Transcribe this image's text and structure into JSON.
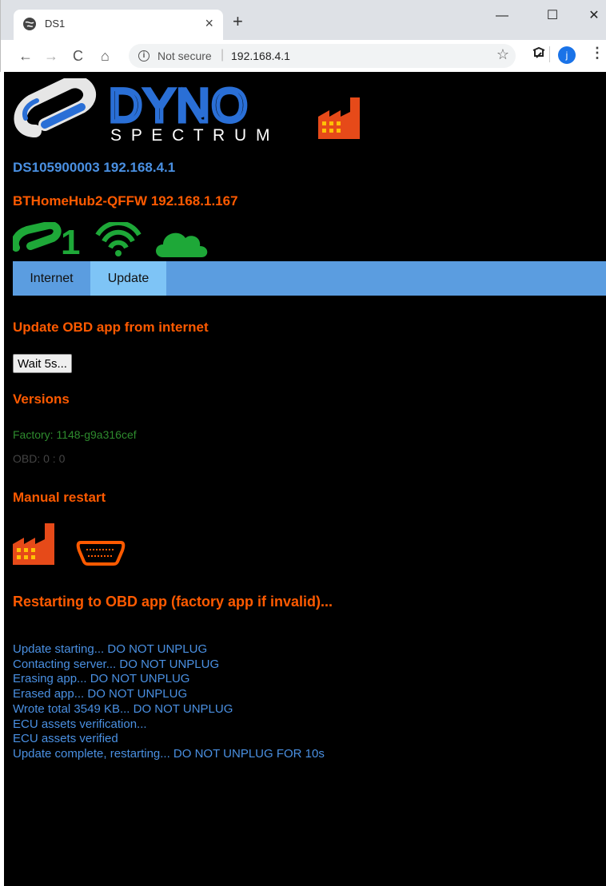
{
  "browser": {
    "tab_title": "DS1",
    "tab_close": "×",
    "new_tab": "+",
    "window_minimize": "—",
    "window_maximize": "☐",
    "window_close": "✕",
    "back": "←",
    "forward": "→",
    "reload": "C",
    "home": "⌂",
    "info": "i",
    "security_label": "Not secure",
    "url_separator": "|",
    "url": "192.168.4.1",
    "star": "☆",
    "profile_initial": "j",
    "menu": "⋮"
  },
  "logo": {
    "word": "DYNO",
    "subword": "S P E C T R U M"
  },
  "colors": {
    "accent_blue": "#4a90e2",
    "accent_orange": "#ff5a00",
    "status_green": "#1ea838",
    "nav_bar": "#5b9de0",
    "nav_active": "#7ec4f6"
  },
  "device": {
    "ap_line": "DS105900003 192.168.4.1",
    "sta_line": "BTHomeHub2-QFFW 192.168.1.167"
  },
  "status_icons": [
    "ds1-logo-icon",
    "wifi-icon",
    "cloud-icon"
  ],
  "status_badge_text": "1",
  "nav": {
    "tabs": [
      {
        "label": "Internet",
        "active": false
      },
      {
        "label": "Update",
        "active": true
      }
    ]
  },
  "update": {
    "heading": "Update OBD app from internet",
    "button_label": "Wait 5s..."
  },
  "versions": {
    "heading": "Versions",
    "factory": "Factory: 1148-g9a316cef",
    "obd": "OBD: 0 : 0"
  },
  "restart": {
    "heading": "Manual restart",
    "icons": [
      "factory-icon",
      "obd-connector-icon"
    ]
  },
  "status_message": "Restarting to OBD app (factory app if invalid)...",
  "log": [
    "Update starting... DO NOT UNPLUG",
    "Contacting server... DO NOT UNPLUG",
    "Erasing app... DO NOT UNPLUG",
    "Erased app... DO NOT UNPLUG",
    "Wrote total 3549 KB... DO NOT UNPLUG",
    "ECU assets verification...",
    "ECU assets verified",
    "Update complete, restarting... DO NOT UNPLUG FOR 10s"
  ]
}
